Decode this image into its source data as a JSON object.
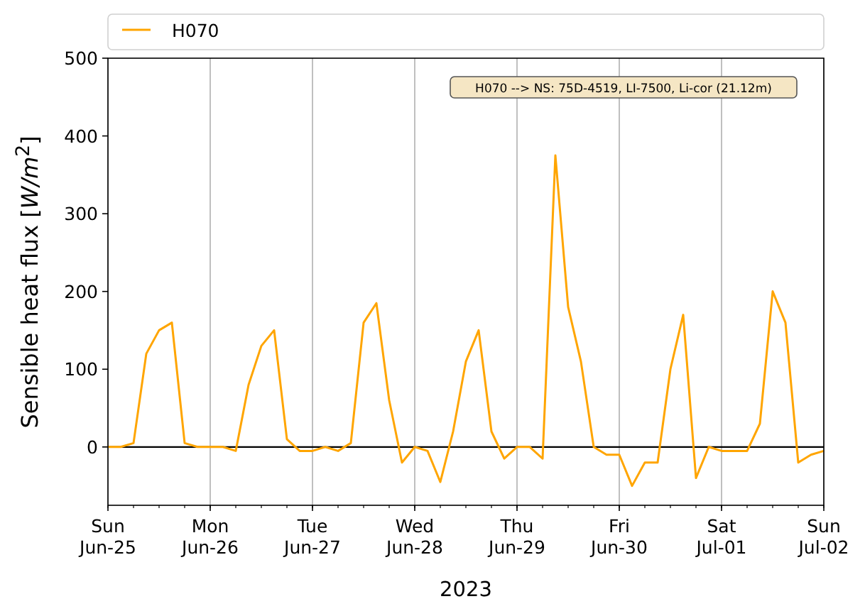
{
  "chart": {
    "annotation": "H070 --> NS: 75D-4519, LI-7500, Li-cor (21.12m)",
    "chart_data": {
      "type": "line",
      "xlabel": "2023",
      "ylabel": "Sensible heat flux [*W/m*$^{2}$]",
      "categories": [
        "Sun\nJun-25",
        null,
        null,
        null,
        null,
        null,
        null,
        null,
        "Mon\nJun-26",
        null,
        null,
        null,
        null,
        null,
        null,
        null,
        "Tue\nJun-27",
        null,
        null,
        null,
        null,
        null,
        null,
        null,
        "Wed\nJun-28",
        null,
        null,
        null,
        null,
        null,
        null,
        null,
        "Thu\nJun-29",
        null,
        null,
        null,
        null,
        null,
        null,
        null,
        "Fri\nJun-30",
        null,
        null,
        null,
        null,
        null,
        null,
        null,
        "Sat\nJul-01",
        null,
        null,
        null,
        null,
        null,
        null,
        null,
        "Sun\nJul-02"
      ],
      "series": [
        {
          "name": "H070",
          "color": "#ffa500",
          "values": [
            0,
            0,
            5,
            120,
            150,
            160,
            5,
            0,
            0,
            0,
            -5,
            80,
            130,
            150,
            10,
            -5,
            -5,
            0,
            -5,
            5,
            160,
            185,
            60,
            -20,
            0,
            -5,
            -45,
            20,
            110,
            150,
            20,
            -15,
            0,
            0,
            -15,
            375,
            180,
            110,
            0,
            -10,
            -10,
            -50,
            -20,
            -20,
            100,
            170,
            -40,
            0,
            -5,
            -5,
            -5,
            30,
            200,
            160,
            -20,
            -10,
            -5
          ]
        }
      ],
      "ylim": [
        -75,
        500
      ],
      "yticks": [
        0,
        100,
        200,
        300,
        400,
        500
      ],
      "grid": "x"
    }
  }
}
